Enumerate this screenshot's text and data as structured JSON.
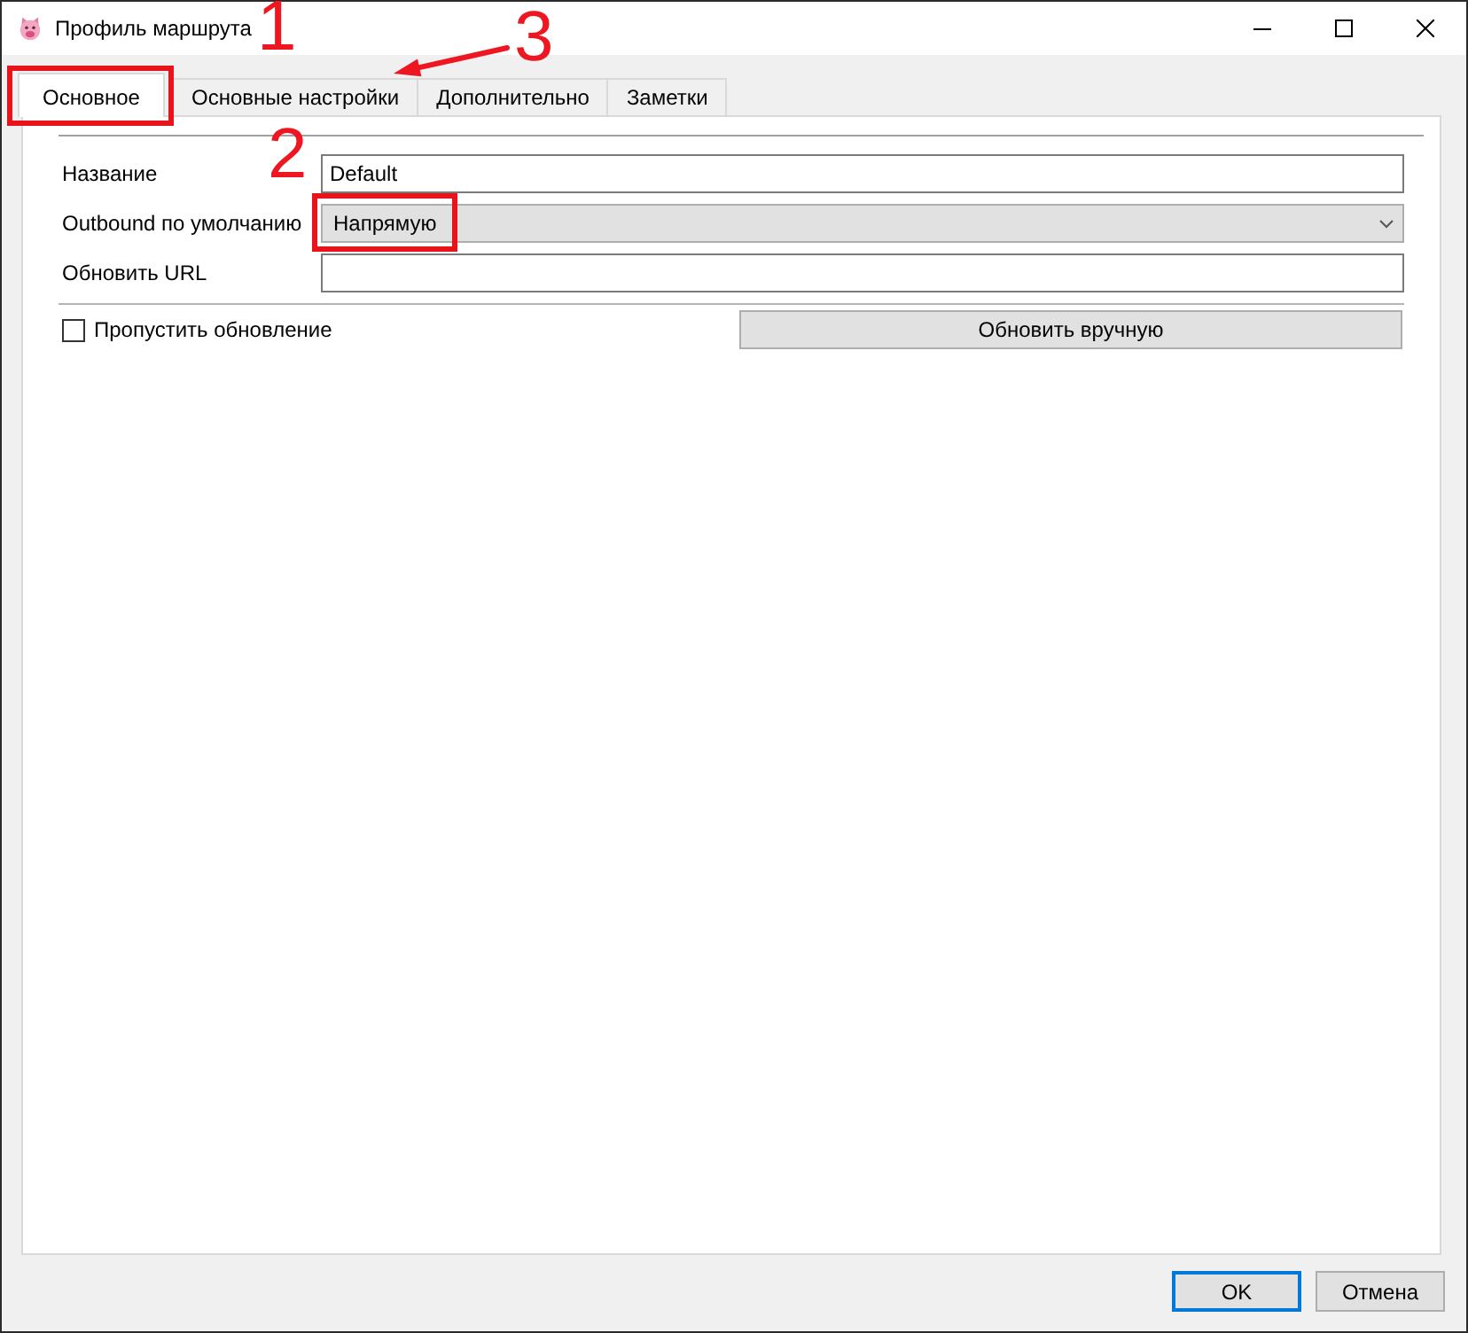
{
  "window": {
    "title": "Профиль маршрута"
  },
  "tabs": [
    {
      "label": "Основное",
      "selected": true
    },
    {
      "label": "Основные настройки",
      "selected": false
    },
    {
      "label": "Дополнительно",
      "selected": false
    },
    {
      "label": "Заметки",
      "selected": false
    }
  ],
  "form": {
    "fields": [
      {
        "kind": "text",
        "label": "Название",
        "value": "Default"
      },
      {
        "kind": "dropdown",
        "label": "Outbound по умолчанию",
        "value": "Напрямую"
      },
      {
        "kind": "text",
        "label": "Обновить URL"
      }
    ],
    "skip_update": {
      "label": "Пропустить обновление",
      "checked": false
    },
    "update_button": {
      "label": "Обновить вручную"
    }
  },
  "buttons": [
    {
      "label": "OK",
      "default": true
    },
    {
      "label": "Отмена",
      "default": false
    }
  ],
  "callouts": [
    {
      "number": "1",
      "kind": "box"
    },
    {
      "number": "2",
      "kind": "box"
    },
    {
      "number": "3",
      "kind": "arrow"
    }
  ]
}
